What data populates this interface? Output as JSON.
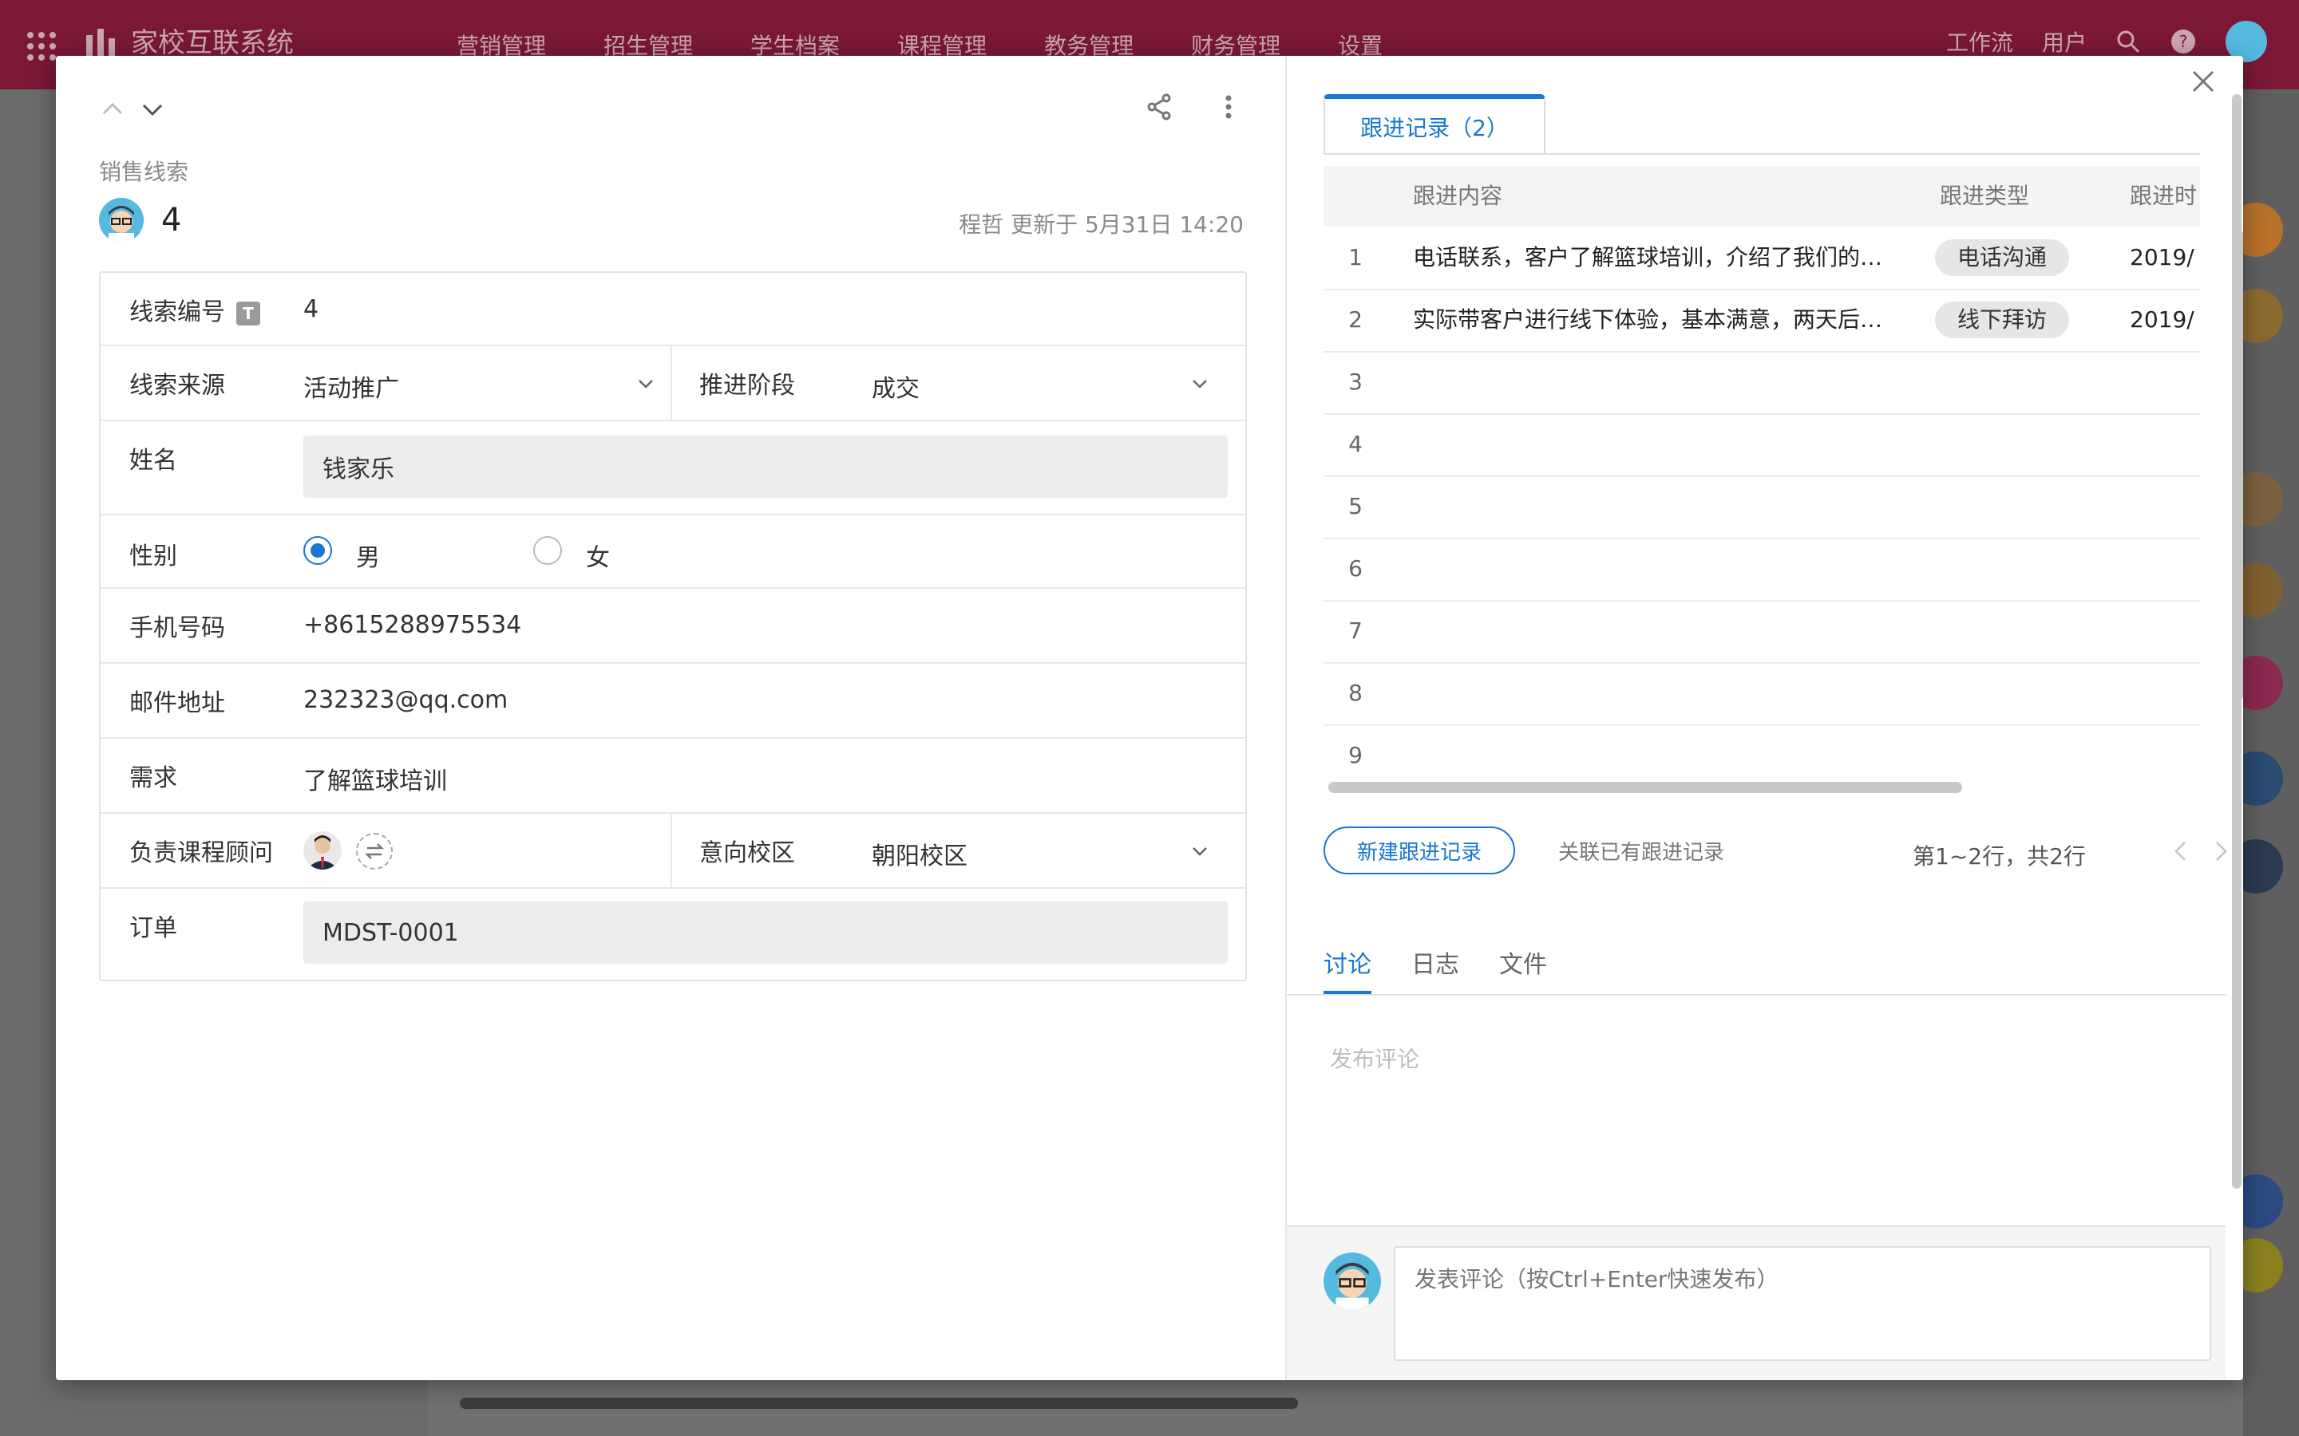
{
  "app": {
    "title": "家校互联系统",
    "nav": [
      "营销管理",
      "招生管理",
      "学生档案",
      "课程管理",
      "教务管理",
      "财务管理",
      "设置"
    ],
    "workflow_label": "工作流",
    "user_label": "用户"
  },
  "record": {
    "breadcrumb": "销售线索",
    "title": "4",
    "updated_by": "程哲",
    "updated_text": "更新于 5月31日 14:20"
  },
  "form": {
    "clue_no": {
      "label": "线索编号",
      "type_badge": "T",
      "value": "4"
    },
    "source": {
      "label": "线索来源",
      "value": "活动推广"
    },
    "stage": {
      "label": "推进阶段",
      "value": "成交"
    },
    "name": {
      "label": "姓名",
      "value": "钱家乐"
    },
    "gender": {
      "label": "性别",
      "options": [
        "男",
        "女"
      ],
      "selected": "男"
    },
    "phone": {
      "label": "手机号码",
      "value": "+8615288975534"
    },
    "email": {
      "label": "邮件地址",
      "value": "232323@qq.com"
    },
    "need": {
      "label": "需求",
      "value": "了解篮球培训"
    },
    "advisor": {
      "label": "负责课程顾问"
    },
    "campus": {
      "label": "意向校区",
      "value": "朝阳校区"
    },
    "order": {
      "label": "订单",
      "value": "MDST-0001"
    }
  },
  "followup": {
    "tab_label": "跟进记录（2）",
    "columns": [
      "跟进内容",
      "跟进类型",
      "跟进时"
    ],
    "rows": [
      {
        "no": "1",
        "content": "电话联系，客户了解篮球培训，介绍了我们的…",
        "type": "电话沟通",
        "date": "2019/"
      },
      {
        "no": "2",
        "content": "实际带客户进行线下体验，基本满意，两天后…",
        "type": "线下拜访",
        "date": "2019/"
      }
    ],
    "empty_rows": [
      "3",
      "4",
      "5",
      "6",
      "7",
      "8",
      "9"
    ],
    "new_button": "新建跟进记录",
    "link_existing": "关联已有跟进记录",
    "pager_text": "第1~2行，共2行"
  },
  "bottom_tabs": [
    "讨论",
    "日志",
    "文件"
  ],
  "discussion": {
    "placeholder": "发布评论",
    "input_placeholder": "发表评论（按Ctrl+Enter快速发布）"
  },
  "colors": {
    "accent": "#1976d2",
    "topbar": "#7a1836"
  }
}
